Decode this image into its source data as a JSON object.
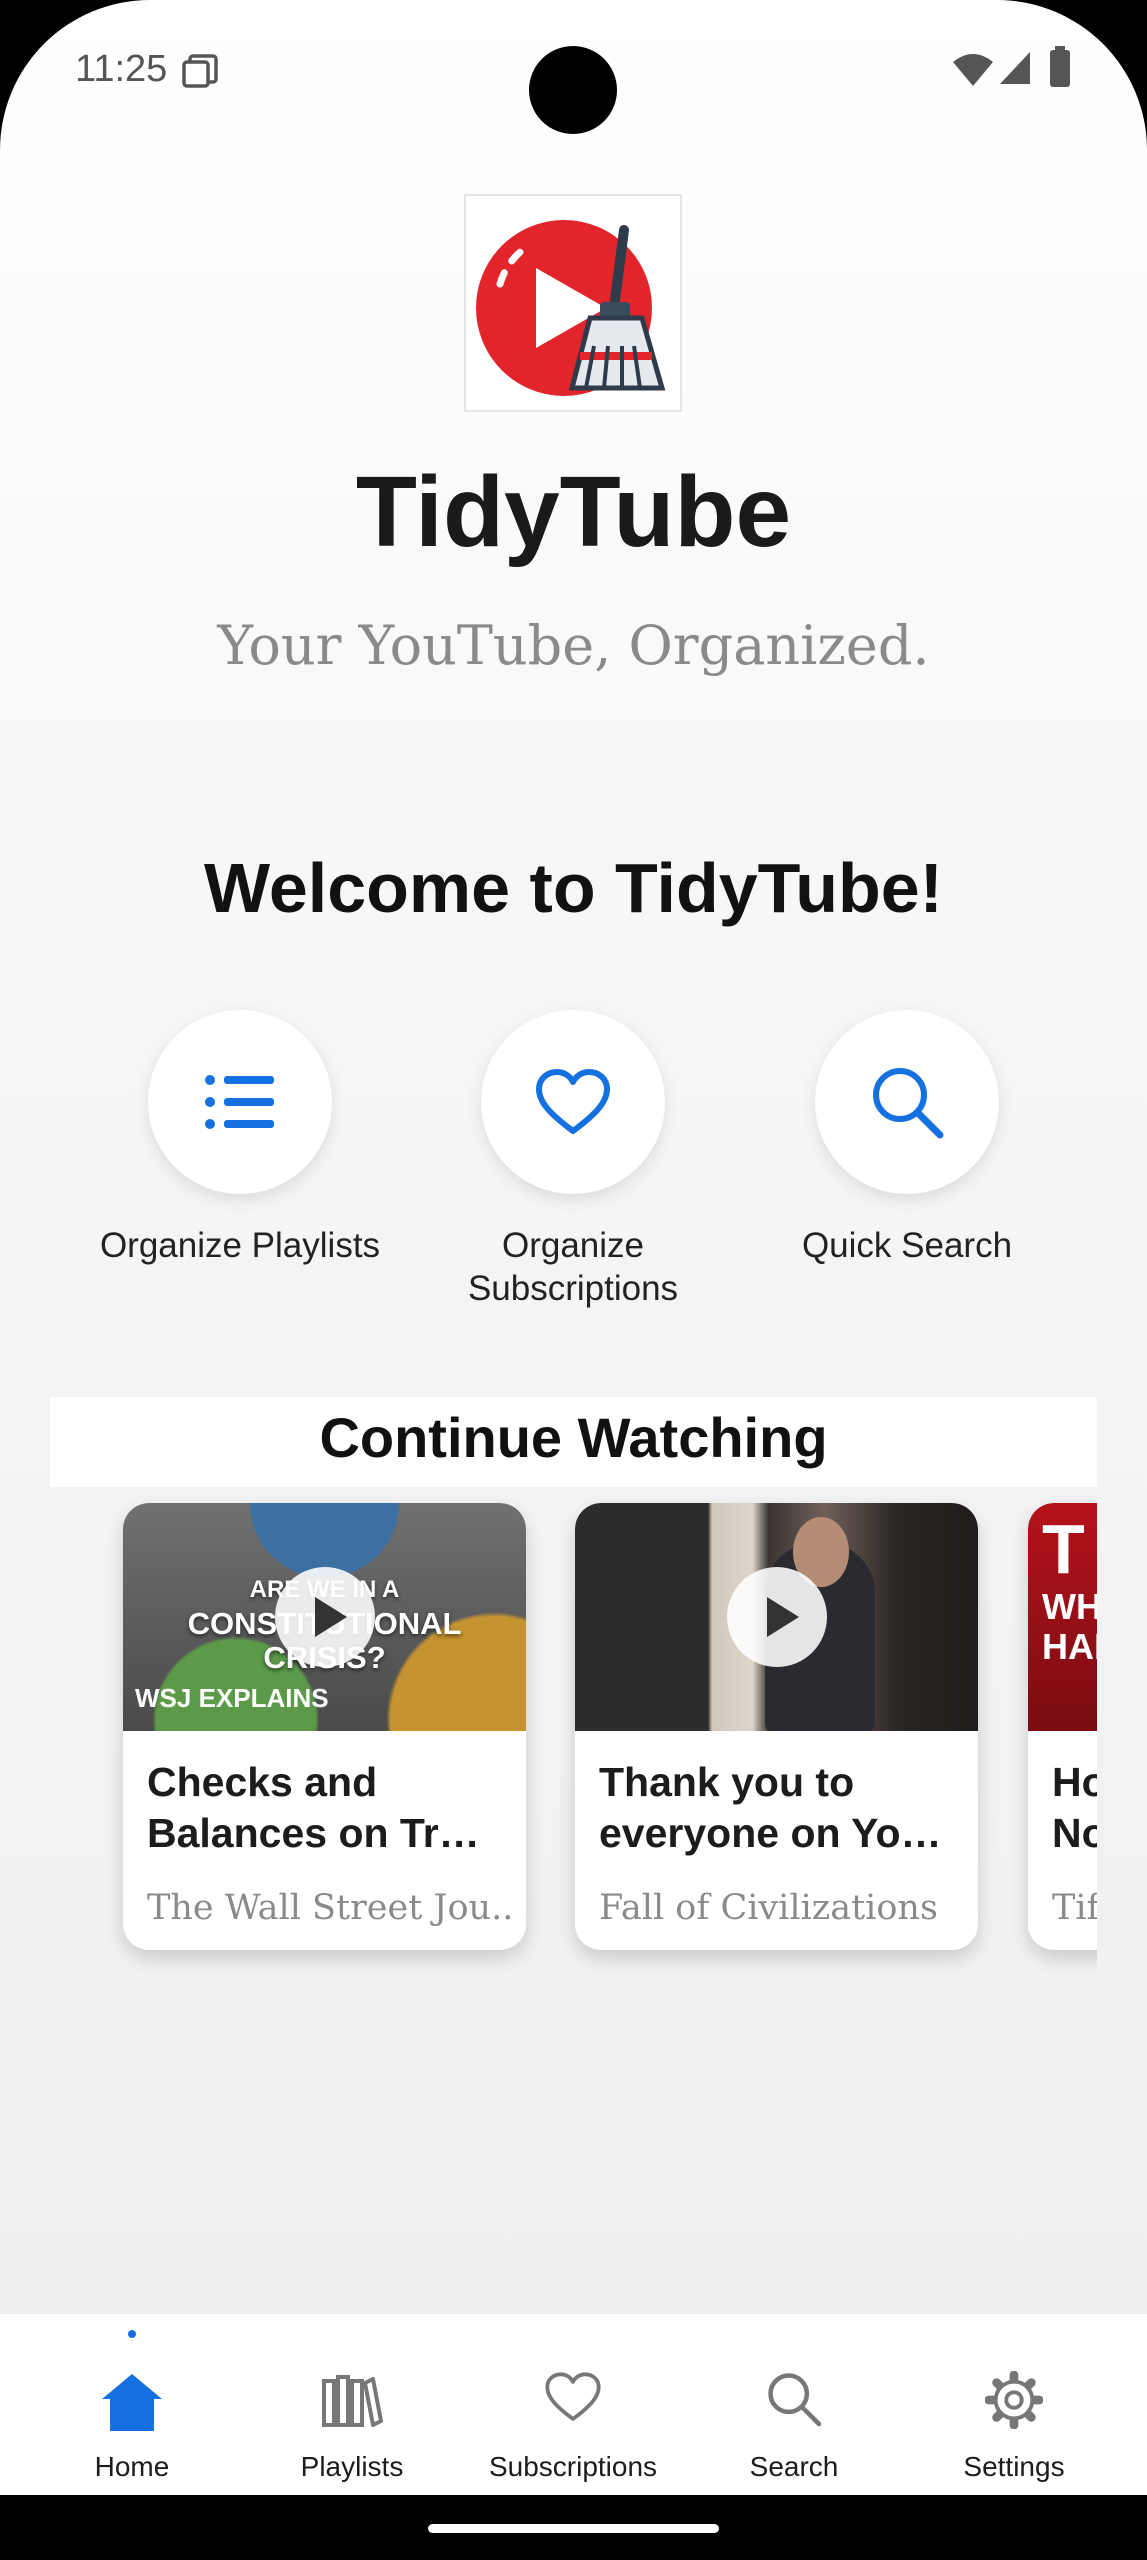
{
  "status_bar": {
    "time": "11:25"
  },
  "header": {
    "app_title": "TidyTube",
    "tagline": "Your YouTube, Organized."
  },
  "welcome": "Welcome to TidyTube!",
  "quick_actions": [
    {
      "label": "Organize Playlists",
      "icon": "list-icon"
    },
    {
      "label": "Organize Subscriptions",
      "icon": "heart-icon"
    },
    {
      "label": "Quick Search",
      "icon": "search-icon"
    }
  ],
  "continue_watching": {
    "title": "Continue Watching",
    "cards": [
      {
        "title": "Checks and Balances on Tr…",
        "channel": "The Wall Street Jou..",
        "thumb_text": [
          "ARE WE IN A",
          "CONSTITUTIONAL",
          "CRISIS?"
        ],
        "thumb_badge": "WSJ EXPLAINS"
      },
      {
        "title": "Thank you to everyone on Yo…",
        "channel": "Fall of Civilizations"
      },
      {
        "title": "Ho No",
        "channel": "Tif",
        "thumb_text": [
          "T",
          "WH",
          "HAP"
        ]
      }
    ]
  },
  "bottom_nav": [
    {
      "label": "Home",
      "icon": "home-icon",
      "active": true
    },
    {
      "label": "Playlists",
      "icon": "library-icon"
    },
    {
      "label": "Subscriptions",
      "icon": "heart-icon"
    },
    {
      "label": "Search",
      "icon": "search-icon"
    },
    {
      "label": "Settings",
      "icon": "gear-icon"
    }
  ],
  "colors": {
    "accent": "#1570e0",
    "logo_red": "#e2252b",
    "text": "#1a1a1a"
  }
}
